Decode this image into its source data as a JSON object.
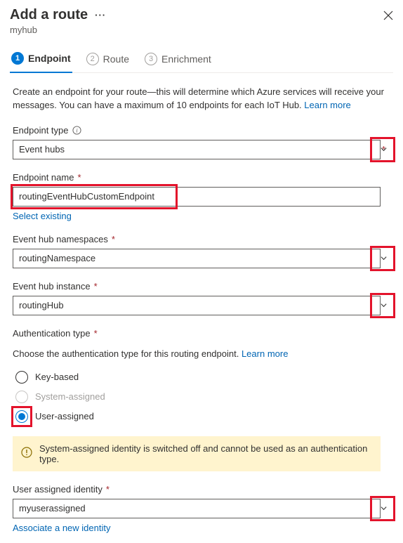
{
  "header": {
    "title": "Add a route",
    "subtitle": "myhub"
  },
  "tabs": [
    {
      "num": "1",
      "label": "Endpoint"
    },
    {
      "num": "2",
      "label": "Route"
    },
    {
      "num": "3",
      "label": "Enrichment"
    }
  ],
  "intro": {
    "text": "Create an endpoint for your route—this will determine which Azure services will receive your messages. You can have a maximum of 10 endpoints for each IoT Hub. ",
    "link": "Learn more"
  },
  "fields": {
    "endpointType": {
      "label": "Endpoint type",
      "value": "Event hubs"
    },
    "endpointName": {
      "label": "Endpoint name",
      "value": "routingEventHubCustomEndpoint",
      "existing": "Select existing"
    },
    "namespaces": {
      "label": "Event hub namespaces",
      "value": "routingNamespace"
    },
    "instance": {
      "label": "Event hub instance",
      "value": "routingHub"
    },
    "authType": {
      "label": "Authentication type"
    },
    "authDesc": {
      "text": "Choose the authentication type for this routing endpoint. ",
      "link": "Learn more"
    },
    "radios": {
      "key": "Key-based",
      "system": "System-assigned",
      "user": "User-assigned"
    },
    "banner": "System-assigned identity is switched off and cannot be used as an authentication type.",
    "userIdentity": {
      "label": "User assigned identity",
      "value": "myuserassigned",
      "associate": "Associate a new identity"
    }
  }
}
